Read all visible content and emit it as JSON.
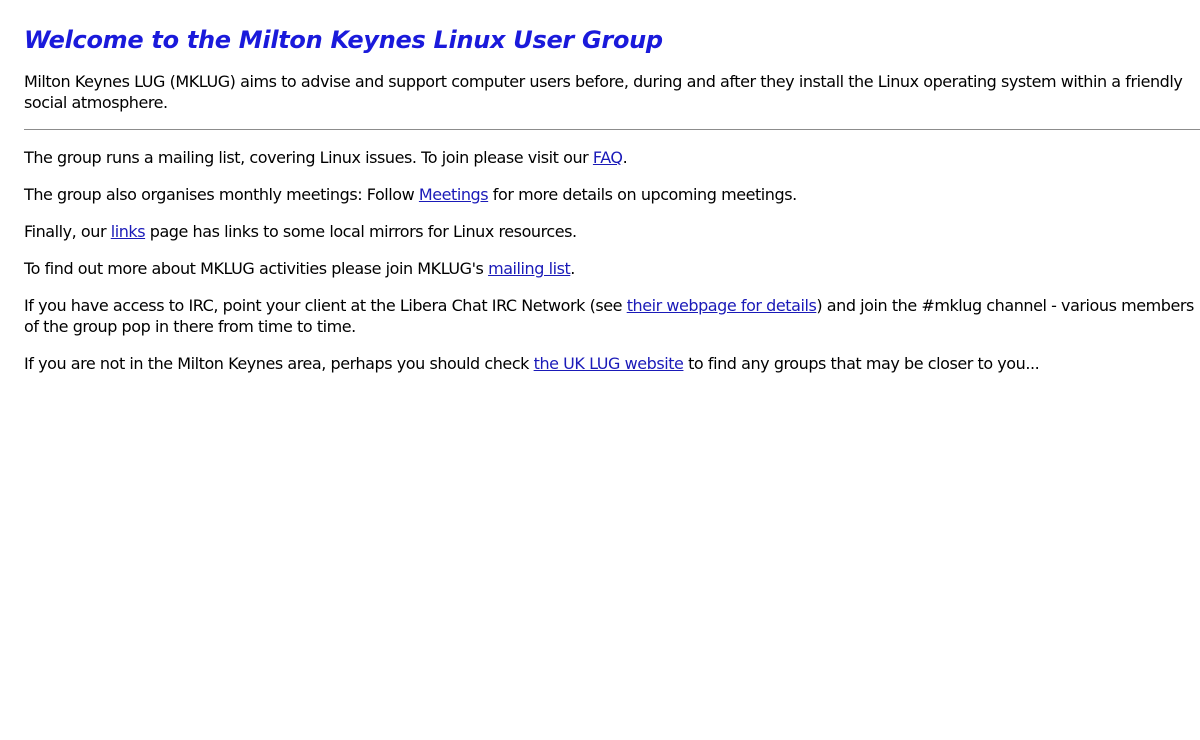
{
  "page": {
    "title": "Welcome to the Milton Keynes Linux User Group",
    "intro": "Milton Keynes LUG (MKLUG) aims to advise and support computer users before, during and after they install the Linux operating system within a friendly social atmosphere."
  },
  "paragraphs": {
    "mailing": {
      "before": "The group runs a mailing list, covering Linux issues. To join please visit our ",
      "link": "FAQ",
      "after": "."
    },
    "meetings": {
      "before": "The group also organises monthly meetings: Follow ",
      "link": "Meetings",
      "after": " for more details on upcoming meetings."
    },
    "links": {
      "before": "Finally, our ",
      "link": "links",
      "after": " page has links to some local mirrors for Linux resources."
    },
    "activities": {
      "before": "To find out more about MKLUG activities please join MKLUG's ",
      "link": "mailing list",
      "after": "."
    },
    "irc": {
      "before": "If you have access to IRC, point your client at the Libera Chat IRC Network (see ",
      "link": "their webpage for details",
      "after": ") and join the #mklug channel - various members of the group pop in there from time to time."
    },
    "uklug": {
      "before": "If you are not in the Milton Keynes area, perhaps you should check ",
      "link": "the UK LUG website",
      "after": " to find any groups that may be closer to you..."
    }
  },
  "colors": {
    "title": "#1a1adb",
    "link": "#1a1ab8",
    "divider": "#8c8c8c"
  }
}
